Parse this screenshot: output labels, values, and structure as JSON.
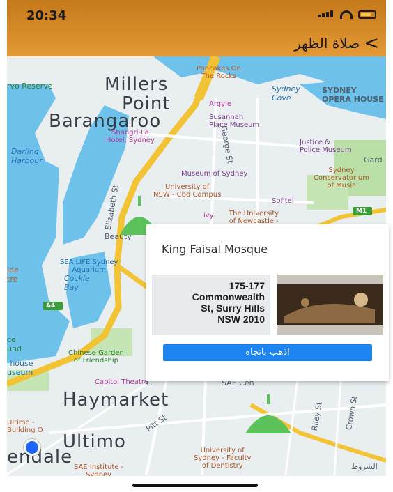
{
  "status": {
    "time": "20:34"
  },
  "nav": {
    "title": "صلاة الظهر"
  },
  "map": {
    "labels": {
      "millers": "Millers",
      "point": "Point",
      "barangaroo": "Barangaroo",
      "haymarket": "Haymarket",
      "ultimo": "Ultimo",
      "endale": "endale",
      "darling_harbour": "Darling\nHarbour",
      "cockle_bay": "Cockle\nBay",
      "darli": "Darli",
      "reserve": "rvo Reserve",
      "pancakes": "Pancakes On\nThe Rocks",
      "sydney_cove": "Sydney\nCove",
      "opera": "SYDNEY\nOPERA HOUSE",
      "argyle": "Argyle",
      "susannah": "Susannah\nPlace Museum",
      "shangri": "Shangri-La\nHotel, Sydney",
      "justice": "Justice &\nPolice Museum",
      "gard": "Gard",
      "museum_syd": "Museum of Sydney",
      "sydney_conserv": "Sydney\nConservatorium\nof Music",
      "uni_syd": "University of\nNSW - Cbd Campus",
      "sofitel": "Sofitel",
      "ivy": "ivy",
      "uni_newcastle": "The University\nof Newcastle -",
      "beauty": "Beauty",
      "sea_life": "SEA LIFE Sydney\nAquarium",
      "chinese_garden": "Chinese Garden\nof Friendship",
      "capitol": "Capitol Theatre",
      "ultimo_building": "Ultimo -\nBuilding O",
      "uni_syd_dent": "University of\nSydney - Faculty\nof Dentistry",
      "sae": "SAE Institute -\nSydney",
      "pitt_st": "Pitt St",
      "george_st": "George St",
      "crown_st": "Crown St",
      "riley_st": "Riley St",
      "elizabeth_st": "Elizabeth St",
      "sae_cen": "SAE Cen",
      "a4": "A4",
      "m1": "M1",
      "ide_tre": "ide\ntre",
      "ce_und": "ce\nund",
      "rhouse": "rhouse\nuseum",
      "c_label": "C",
      "legal": "الشروط"
    }
  },
  "card": {
    "title": "King Faisal Mosque",
    "address_lines": [
      "175-177",
      "Commonwealth",
      "St, Surry Hills",
      "NSW 2010"
    ],
    "button_label": "اذهب باتجاه"
  },
  "colors": {
    "accent": "#1e84f0",
    "header": "#d68a28",
    "pin": "#5cc35a"
  }
}
